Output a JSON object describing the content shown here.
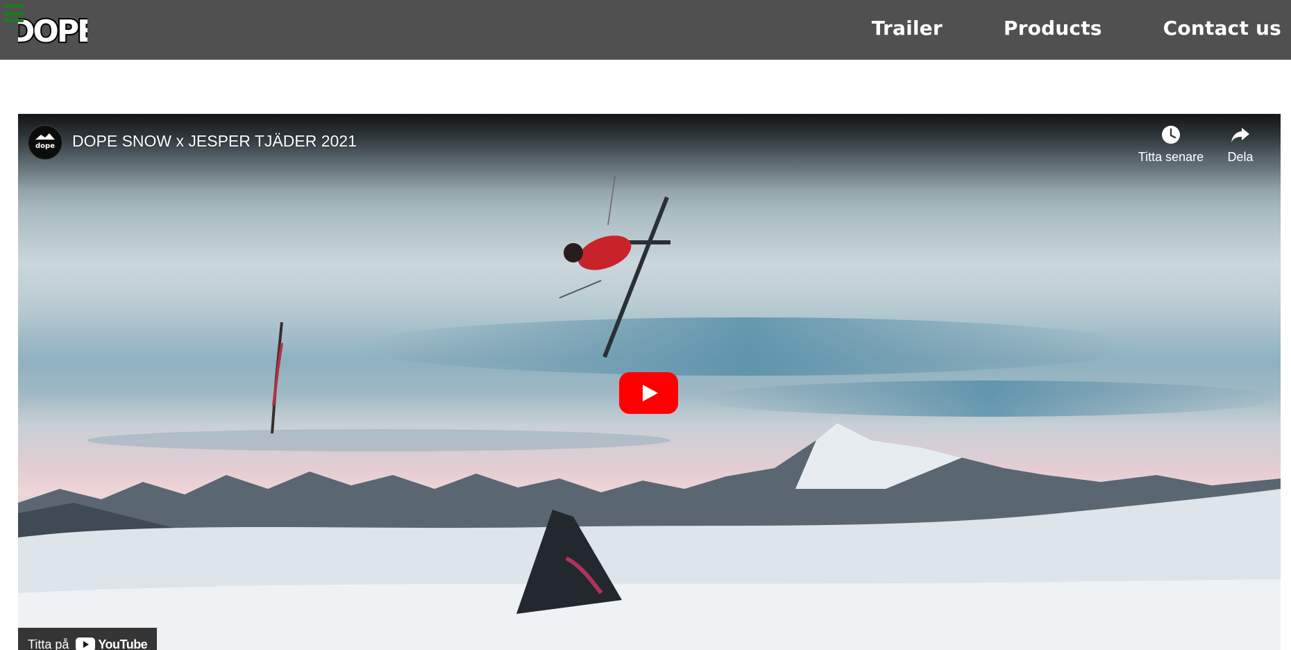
{
  "header": {
    "logo_text": "DOPE",
    "nav": [
      {
        "label": "Trailer"
      },
      {
        "label": "Products"
      },
      {
        "label": "Contact us"
      }
    ]
  },
  "video": {
    "title": "DOPE SNOW x JESPER TJÄDER 2021",
    "channel_avatar_text": "dope",
    "actions": {
      "watch_later": "Titta senare",
      "share": "Dela"
    },
    "watch_on": "Titta på",
    "youtube_word": "YouTube"
  },
  "colors": {
    "header_bg": "#505050",
    "menu_green": "#1f7a1f",
    "play_red": "#ff0000"
  }
}
